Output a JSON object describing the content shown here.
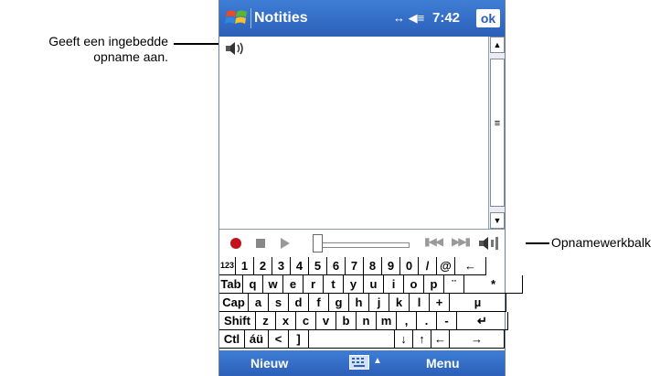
{
  "callouts": {
    "embedded": "Geeft een ingebedde opname aan.",
    "toolbar": "Opnamewerkbalk"
  },
  "device": {
    "title": "Notities",
    "clock": "7:42",
    "ok_label": "ok",
    "status_icons": "↔ ◀≡"
  },
  "icons": {
    "start": "windows-flag-icon",
    "audio": "embedded-recording-icon",
    "record": "record-icon",
    "stop": "stop-icon",
    "play": "play-icon",
    "speaker": "speaker-icon"
  },
  "scrollbar": {
    "up": "▲",
    "down": "▼",
    "grip": "≡"
  },
  "toolbar": {
    "skip_back": "▮◀◀",
    "skip_forward": "▶▶▮",
    "position": 0
  },
  "keyboard": {
    "rows": [
      [
        "123",
        "1",
        "2",
        "3",
        "4",
        "5",
        "6",
        "7",
        "8",
        "9",
        "0",
        "/",
        "@",
        "←"
      ],
      [
        "Tab",
        "q",
        "w",
        "e",
        "r",
        "t",
        "y",
        "u",
        "i",
        "o",
        "p",
        "¨",
        "*"
      ],
      [
        "Cap",
        "a",
        "s",
        "d",
        "f",
        "g",
        "h",
        "j",
        "k",
        "l",
        "+",
        "µ"
      ],
      [
        "Shift",
        "z",
        "x",
        "c",
        "v",
        "b",
        "n",
        "m",
        ",",
        ".",
        "-",
        "↵"
      ],
      [
        "Ctl",
        "áü",
        "<",
        "]",
        " ",
        "↓",
        "↑",
        "←",
        "→"
      ]
    ]
  },
  "menubar": {
    "new_label": "Nieuw",
    "menu_label": "Menu",
    "kb_arrow": "▲"
  },
  "colors": {
    "titlebar": "#2b5fb8",
    "record": "#c0131b"
  }
}
